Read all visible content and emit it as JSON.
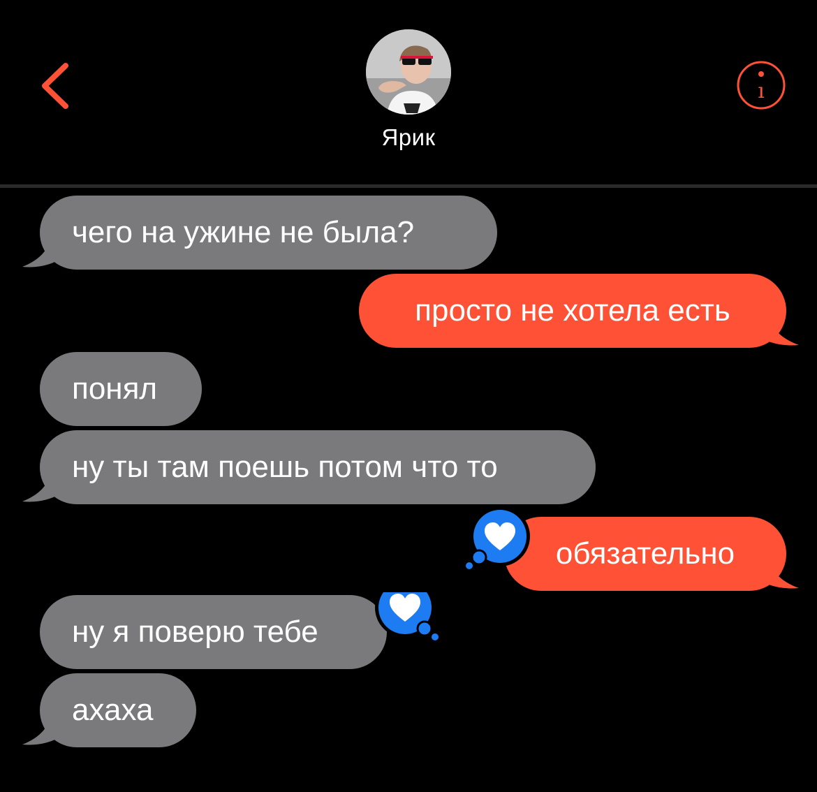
{
  "header": {
    "contact_name": "Ярик",
    "back_icon": "chevron-left-icon",
    "info_icon": "info-circle-icon"
  },
  "colors": {
    "accent": "#ff5135",
    "incoming_bubble": "#7a7a7c",
    "tapback_blue": "#1e7cf2",
    "background": "#000000"
  },
  "messages": [
    {
      "direction": "incoming",
      "text": "чего на ужине не была?"
    },
    {
      "direction": "outgoing",
      "text": "просто не хотела есть"
    },
    {
      "direction": "incoming",
      "text": "понял"
    },
    {
      "direction": "incoming",
      "text": "ну ты там поешь потом что то"
    },
    {
      "direction": "outgoing",
      "text": "обязательно",
      "reaction": "heart-icon"
    },
    {
      "direction": "incoming",
      "text": "ну я поверю тебе",
      "reaction": "heart-icon"
    },
    {
      "direction": "incoming",
      "text": "ахаха"
    }
  ]
}
